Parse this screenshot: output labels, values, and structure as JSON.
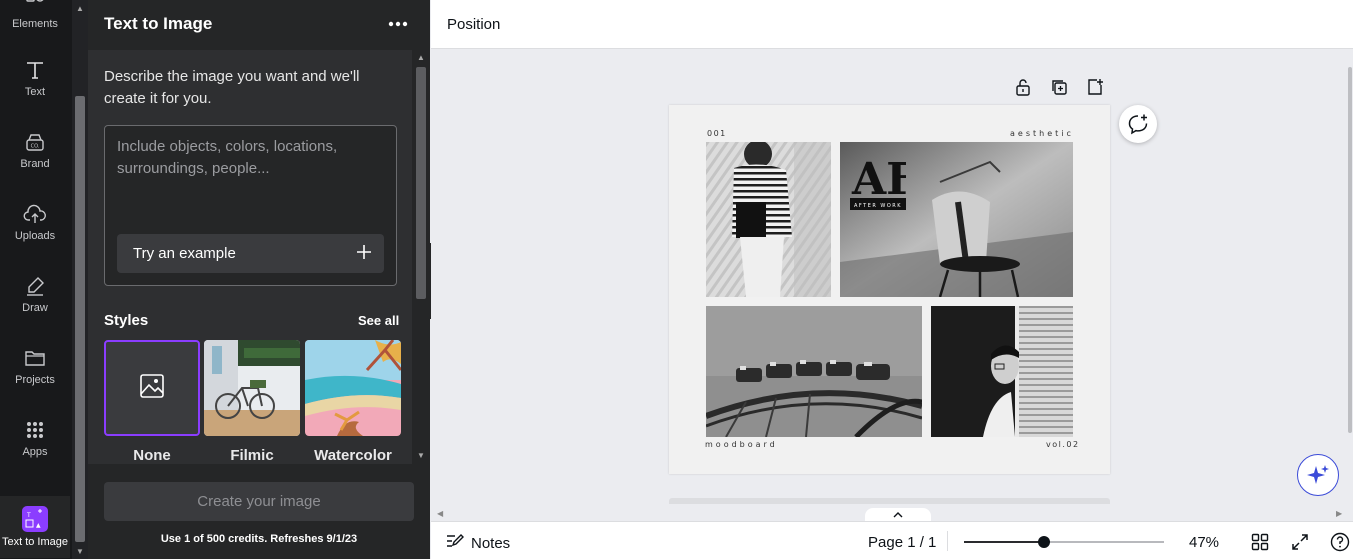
{
  "rail": {
    "items": [
      {
        "label": "Elements",
        "icon": "elements-icon"
      },
      {
        "label": "Text",
        "icon": "text-icon"
      },
      {
        "label": "Brand",
        "icon": "brand-icon"
      },
      {
        "label": "Uploads",
        "icon": "upload-cloud-icon"
      },
      {
        "label": "Draw",
        "icon": "draw-icon"
      },
      {
        "label": "Projects",
        "icon": "folder-icon"
      },
      {
        "label": "Apps",
        "icon": "apps-grid-icon"
      },
      {
        "label": "Text to Image",
        "icon": "text-to-image-icon"
      }
    ]
  },
  "panel": {
    "title": "Text to Image",
    "description": "Describe the image you want and we'll create it for you.",
    "prompt_placeholder": "Include objects, colors, locations, surroundings, people...",
    "prompt_value": "",
    "try_example": "Try an example",
    "styles_title": "Styles",
    "see_all": "See all",
    "styles": [
      {
        "label": "None",
        "selected": true
      },
      {
        "label": "Filmic",
        "selected": false
      },
      {
        "label": "Watercolor",
        "selected": false
      }
    ],
    "create_button": "Create your image",
    "credits": "Use 1 of 500 credits. Refreshes 9/1/23"
  },
  "topbar": {
    "position": "Position"
  },
  "design": {
    "number": "001",
    "tag": "aesthetic",
    "footer_left": "moodboard",
    "footer_right": "vol.02",
    "logo_letters": "AF",
    "logo_caption": "AFTER WORK"
  },
  "bottombar": {
    "notes": "Notes",
    "page": "Page 1 / 1",
    "zoom_label": "47%",
    "zoom_fraction": 0.4
  },
  "colors": {
    "accent": "#8b3dff",
    "rail_bg": "#18191b",
    "panel_bg": "#252627",
    "canvas_bg": "#ebecf0",
    "magic": "#3b4bd8"
  }
}
